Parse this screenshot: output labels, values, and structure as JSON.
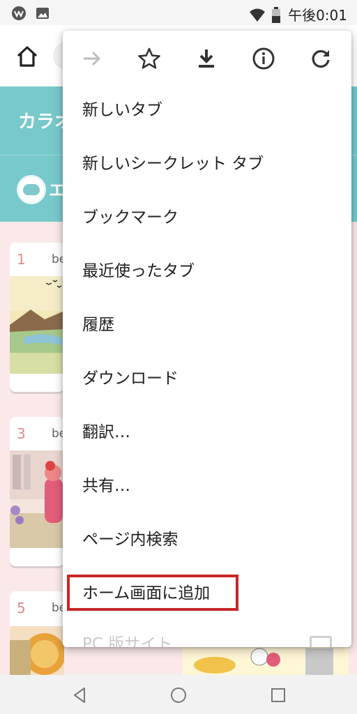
{
  "status_bar": {
    "time": "午後0:01"
  },
  "site": {
    "title": "カラオ",
    "subtitle": "エ",
    "cards": [
      {
        "rank": "1",
        "text": "be"
      },
      {
        "rank": "3",
        "text": "be"
      },
      {
        "rank": "5",
        "text": "be"
      }
    ]
  },
  "menu": {
    "icons": [
      "forward-icon",
      "star-icon",
      "download-icon",
      "info-icon",
      "refresh-icon"
    ],
    "items": [
      "新しいタブ",
      "新しいシークレット タブ",
      "ブックマーク",
      "最近使ったタブ",
      "履歴",
      "ダウンロード",
      "翻訳…",
      "共有…",
      "ページ内検索",
      "ホーム画面に追加",
      "PC 版サイト"
    ],
    "highlight_color": "#c62828"
  },
  "colors": {
    "header_teal": "#77c9cb",
    "content_pink": "#fbe9ea"
  }
}
